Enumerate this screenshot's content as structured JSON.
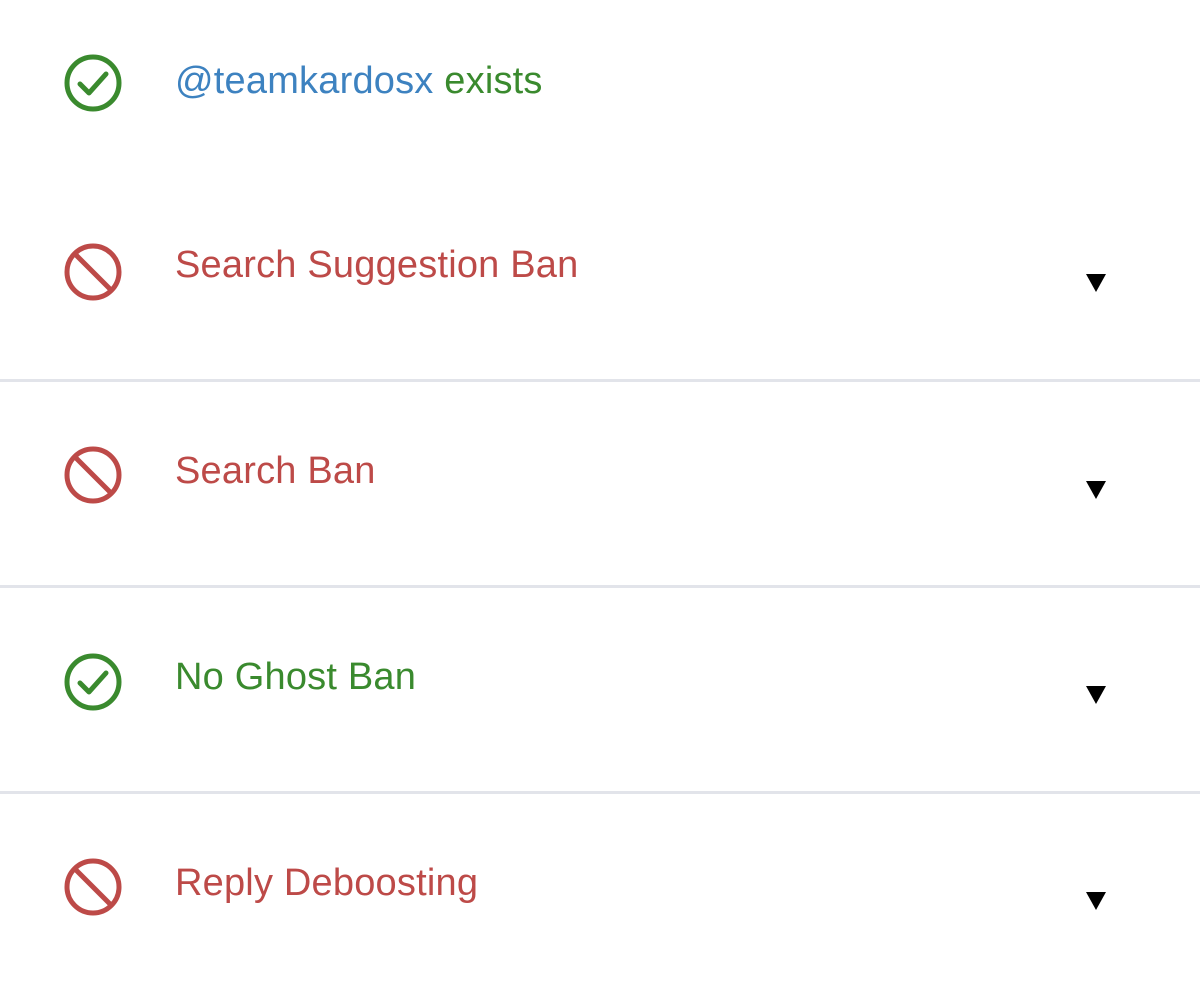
{
  "colors": {
    "pass": "#3a8a2e",
    "fail": "#bd4a48",
    "handle": "#3d82c0",
    "divider": "#e2e4ea",
    "caret": "#000000"
  },
  "header": {
    "handle": "@teamkardosx",
    "status_text": "exists",
    "icon": "check-circle-icon"
  },
  "checks": [
    {
      "label": "Search Suggestion Ban",
      "status": "fail",
      "icon": "prohibited-icon",
      "expand_icon": "caret-down-icon"
    },
    {
      "label": "Search Ban",
      "status": "fail",
      "icon": "prohibited-icon",
      "expand_icon": "caret-down-icon"
    },
    {
      "label": "No Ghost Ban",
      "status": "pass",
      "icon": "check-circle-icon",
      "expand_icon": "caret-down-icon"
    },
    {
      "label": "Reply Deboosting",
      "status": "fail",
      "icon": "prohibited-icon",
      "expand_icon": "caret-down-icon"
    }
  ]
}
